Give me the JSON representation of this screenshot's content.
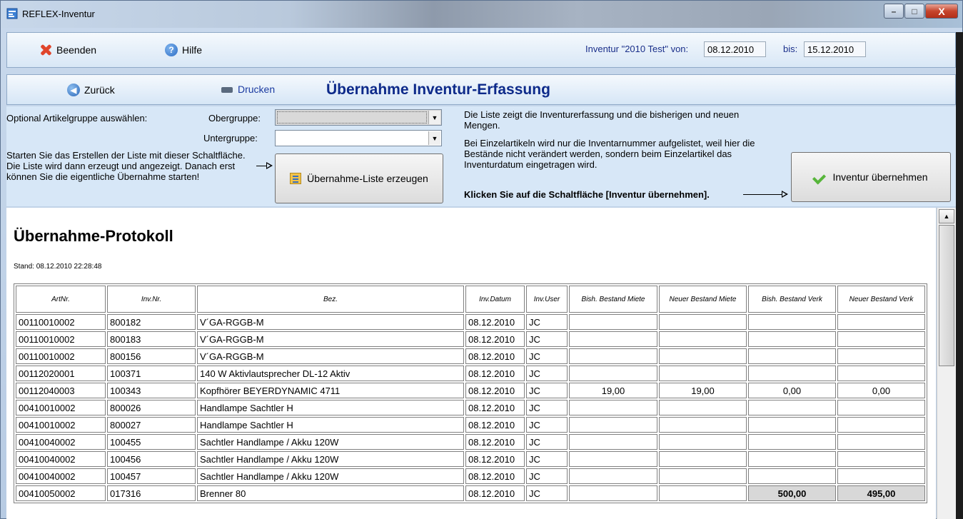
{
  "window": {
    "title": "REFLEX-Inventur",
    "minimize": "–",
    "maximize": "□",
    "close": "X"
  },
  "toolbar1": {
    "exit_label": "Beenden",
    "help_label": "Hilfe",
    "inventory_label": "Inventur \"2010 Test\" von:",
    "date_from": "08.12.2010",
    "bis_label": "bis:",
    "date_to": "15.12.2010"
  },
  "toolbar2": {
    "back_label": "Zurück",
    "print_label": "Drucken",
    "page_title": "Übernahme Inventur-Erfassung"
  },
  "options": {
    "group_prompt": "Optional Artikelgruppe auswählen:",
    "obergruppe_label": "Obergruppe:",
    "obergruppe_value": "",
    "untergruppe_label": "Untergruppe:",
    "untergruppe_value": "",
    "start_help": "Starten Sie das Erstellen der Liste mit dieser Schaltfläche. Die Liste wird dann erzeugt und angezeigt. Danach erst können Sie die eigentliche Übernahme starten!",
    "create_list_button": "Übernahme-Liste erzeugen",
    "list_info_1": "Die Liste zeigt die Inventurerfassung und die bisherigen und neuen Mengen.",
    "list_info_2": "Bei Einzelartikeln wird nur die Inventarnummer aufgelistet, weil hier die Bestände nicht verändert werden, sondern beim Einzelartikel das Inventurdatum eingetragen wird.",
    "click_hint": "Klicken Sie auf die Schaltfläche [Inventur übernehmen].",
    "apply_button": "Inventur übernehmen"
  },
  "protocol": {
    "title": "Übernahme-Protokoll",
    "stand": "Stand: 08.12.2010 22:28:48",
    "columns": [
      "ArtNr.",
      "Inv.Nr.",
      "Bez.",
      "Inv.Datum",
      "Inv.User",
      "Bish. Bestand Miete",
      "Neuer Bestand Miete",
      "Bish. Bestand Verk",
      "Neuer Bestand Verk"
    ],
    "rows": [
      {
        "artnr": "00110010002",
        "invnr": "800182",
        "bez": "V´GA-RGGB-M",
        "datum": "08.12.2010",
        "user": "JC",
        "bm": "",
        "nm": "",
        "bv": "",
        "nv": "",
        "shade": false
      },
      {
        "artnr": "00110010002",
        "invnr": "800183",
        "bez": "V´GA-RGGB-M",
        "datum": "08.12.2010",
        "user": "JC",
        "bm": "",
        "nm": "",
        "bv": "",
        "nv": "",
        "shade": false
      },
      {
        "artnr": "00110010002",
        "invnr": "800156",
        "bez": "V´GA-RGGB-M",
        "datum": "08.12.2010",
        "user": "JC",
        "bm": "",
        "nm": "",
        "bv": "",
        "nv": "",
        "shade": false
      },
      {
        "artnr": "00112020001",
        "invnr": "100371",
        "bez": "140 W Aktivlautsprecher DL-12 Aktiv",
        "datum": "08.12.2010",
        "user": "JC",
        "bm": "",
        "nm": "",
        "bv": "",
        "nv": "",
        "shade": false
      },
      {
        "artnr": "00112040003",
        "invnr": "100343",
        "bez": "Kopfhörer BEYERDYNAMIC 4711",
        "datum": "08.12.2010",
        "user": "JC",
        "bm": "19,00",
        "nm": "19,00",
        "bv": "0,00",
        "nv": "0,00",
        "shade": false
      },
      {
        "artnr": "00410010002",
        "invnr": "800026",
        "bez": "Handlampe Sachtler H",
        "datum": "08.12.2010",
        "user": "JC",
        "bm": "",
        "nm": "",
        "bv": "",
        "nv": "",
        "shade": false
      },
      {
        "artnr": "00410010002",
        "invnr": "800027",
        "bez": "Handlampe Sachtler H",
        "datum": "08.12.2010",
        "user": "JC",
        "bm": "",
        "nm": "",
        "bv": "",
        "nv": "",
        "shade": false
      },
      {
        "artnr": "00410040002",
        "invnr": "100455",
        "bez": "Sachtler Handlampe / Akku 120W",
        "datum": "08.12.2010",
        "user": "JC",
        "bm": "",
        "nm": "",
        "bv": "",
        "nv": "",
        "shade": false
      },
      {
        "artnr": "00410040002",
        "invnr": "100456",
        "bez": "Sachtler Handlampe / Akku 120W",
        "datum": "08.12.2010",
        "user": "JC",
        "bm": "",
        "nm": "",
        "bv": "",
        "nv": "",
        "shade": false
      },
      {
        "artnr": "00410040002",
        "invnr": "100457",
        "bez": "Sachtler Handlampe / Akku 120W",
        "datum": "08.12.2010",
        "user": "JC",
        "bm": "",
        "nm": "",
        "bv": "",
        "nv": "",
        "shade": false
      },
      {
        "artnr": "00410050002",
        "invnr": "017316",
        "bez": "Brenner 80",
        "datum": "08.12.2010",
        "user": "JC",
        "bm": "",
        "nm": "",
        "bv": "500,00",
        "nv": "495,00",
        "shade": true
      }
    ]
  }
}
